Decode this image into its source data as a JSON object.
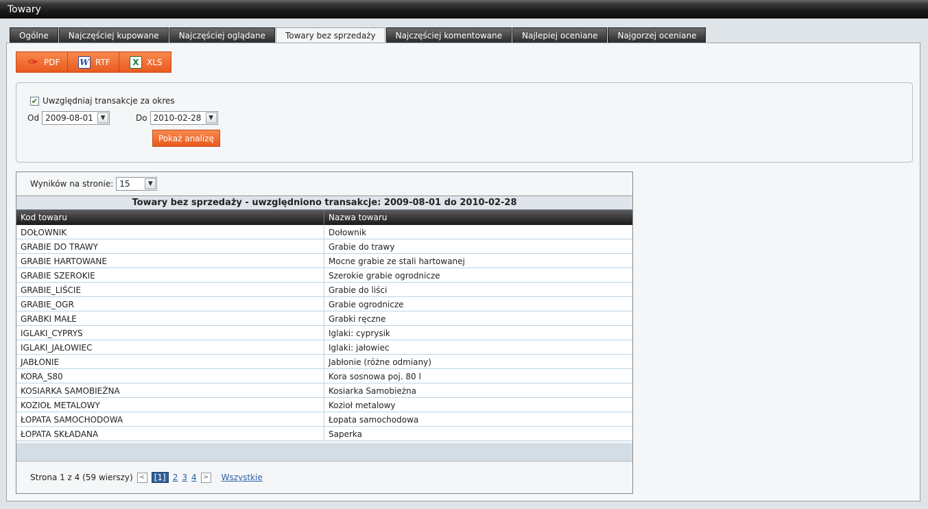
{
  "window": {
    "title": "Towary"
  },
  "tabs": [
    {
      "label": "Ogólne"
    },
    {
      "label": "Najczęściej kupowane"
    },
    {
      "label": "Najczęściej oglądane"
    },
    {
      "label": "Towary bez sprzedaży",
      "active": true
    },
    {
      "label": "Najczęściej komentowane"
    },
    {
      "label": "Najlepiej oceniane"
    },
    {
      "label": "Najgorzej oceniane"
    }
  ],
  "export": {
    "pdf": "PDF",
    "rtf": "RTF",
    "xls": "XLS"
  },
  "filter": {
    "checkbox_label": "Uwzględniaj transakcje za okres",
    "checked": true,
    "from_label": "Od",
    "from_value": "2009-08-01",
    "to_label": "Do",
    "to_value": "2010-02-28",
    "show_button": "Pokaż analizę"
  },
  "results": {
    "per_page_label": "Wyników na stronie:",
    "per_page_value": "15",
    "title": "Towary bez sprzedaży - uwzględniono transakcje: 2009-08-01 do 2010-02-28",
    "columns": [
      "Kod towaru",
      "Nazwa towaru"
    ],
    "rows": [
      [
        "DOŁOWNIK",
        "Dołownik"
      ],
      [
        "GRABIE DO TRAWY",
        "Grabie do trawy"
      ],
      [
        "GRABIE HARTOWANE",
        "Mocne grabie ze stali hartowanej"
      ],
      [
        "GRABIE SZEROKIE",
        "Szerokie grabie ogrodnicze"
      ],
      [
        "GRABIE_LIŚCIE",
        "Grabie do liści"
      ],
      [
        "GRABIE_OGR",
        "Grabie ogrodnicze"
      ],
      [
        "GRABKI MAŁE",
        "Grabki ręczne"
      ],
      [
        "IGLAKI_CYPRYS",
        "Iglaki: cyprysik"
      ],
      [
        "IGLAKI_JAŁOWIEC",
        "Iglaki: jałowiec"
      ],
      [
        "JABŁONIE",
        "Jabłonie (różne odmiany)"
      ],
      [
        "KORA_S80",
        "Kora sosnowa poj. 80 l"
      ],
      [
        "KOSIARKA SAMOBIEŻNA",
        "Kosiarka Samobieżna"
      ],
      [
        "KOZIOŁ METALOWY",
        "Kozioł metalowy"
      ],
      [
        "ŁOPATA SAMOCHODOWA",
        "Łopata samochodowa"
      ],
      [
        "ŁOPATA SKŁADANA",
        "Saperka"
      ]
    ],
    "pager": {
      "summary": "Strona 1 z 4 (59 wierszy)",
      "prev": "<",
      "current": "[1]",
      "pages": [
        "2",
        "3",
        "4"
      ],
      "next": ">",
      "all": "Wszystkie"
    }
  }
}
